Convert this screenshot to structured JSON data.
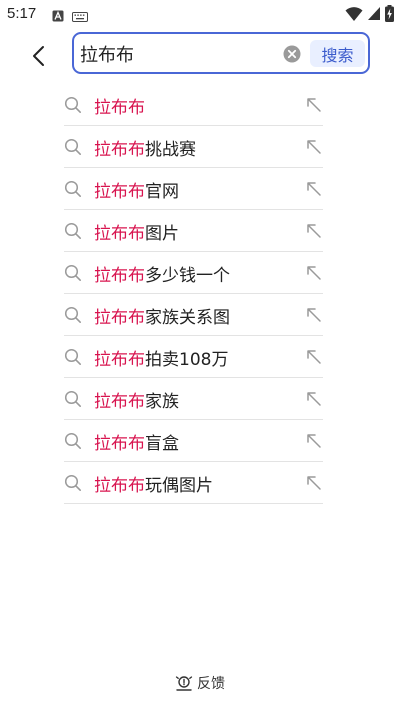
{
  "status_bar": {
    "time": "5:17",
    "left_icons": [
      "a-letter-icon",
      "keyboard-icon"
    ],
    "right_icons": [
      "wifi-icon",
      "cell-signal-icon",
      "battery-charging-icon"
    ]
  },
  "search": {
    "query": "拉布布",
    "button_label": "搜索"
  },
  "colors": {
    "accent": "#4a67d6",
    "highlight": "#d8144f",
    "button_bg": "#e9efff"
  },
  "suggestions": [
    {
      "highlight": "拉布布",
      "rest": ""
    },
    {
      "highlight": "拉布布",
      "rest": "挑战赛"
    },
    {
      "highlight": "拉布布",
      "rest": "官网"
    },
    {
      "highlight": "拉布布",
      "rest": "图片"
    },
    {
      "highlight": "拉布布",
      "rest": "多少钱一个"
    },
    {
      "highlight": "拉布布",
      "rest": "家族关系图"
    },
    {
      "highlight": "拉布布",
      "rest": "拍卖108万"
    },
    {
      "highlight": "拉布布",
      "rest": "家族"
    },
    {
      "highlight": "拉布布",
      "rest": "盲盒"
    },
    {
      "highlight": "拉布布",
      "rest": "玩偶图片"
    }
  ],
  "feedback": {
    "label": "反馈"
  }
}
